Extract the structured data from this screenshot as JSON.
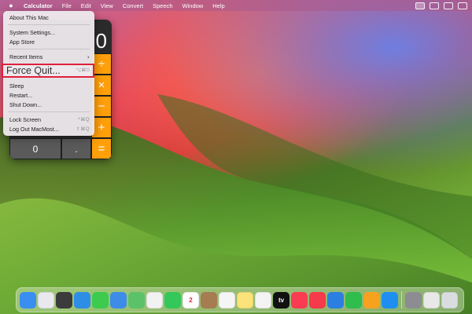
{
  "menubar": {
    "apple_icon": "apple-logo-icon",
    "items": [
      "Calculator",
      "File",
      "Edit",
      "View",
      "Convert",
      "Speech",
      "Window",
      "Help"
    ],
    "status_icons": [
      "screen-mirroring-icon",
      "window-icon",
      "video-icon",
      "control-center-icon"
    ]
  },
  "apple_menu": {
    "about": "About This Mac",
    "system_settings": "System Settings...",
    "app_store": "App Store",
    "recent_items": "Recent Items",
    "recent_items_arrow": "›",
    "force_quit": "Force Quit...",
    "force_quit_shortcut": "⌥⌘⎋",
    "sleep": "Sleep",
    "restart": "Restart...",
    "shut_down": "Shut Down...",
    "lock_screen": "Lock Screen",
    "lock_screen_shortcut": "^⌘Q",
    "log_out": "Log Out MacMost...",
    "log_out_shortcut": "⇧⌘Q",
    "highlight_color": "#e0203a"
  },
  "calculator": {
    "display": "0",
    "keys": {
      "zero": "0",
      "decimal": ".",
      "divide": "÷",
      "multiply": "×",
      "minus": "−",
      "plus": "+",
      "equals": "="
    },
    "colors": {
      "operator": "#ff9f0a",
      "number": "#5a5a5a",
      "body": "#2b2b2b"
    }
  },
  "dock": {
    "icons": [
      {
        "name": "finder-icon",
        "label": "",
        "color": "#3a8ef0"
      },
      {
        "name": "launchpad-icon",
        "label": "",
        "color": "#e8e8ee"
      },
      {
        "name": "calculator-icon",
        "label": "",
        "color": "#3b3b3b"
      },
      {
        "name": "safari-icon",
        "label": "",
        "color": "#2e8ee6"
      },
      {
        "name": "messages-icon",
        "label": "",
        "color": "#3ccb4f"
      },
      {
        "name": "mail-icon",
        "label": "",
        "color": "#3d8de8"
      },
      {
        "name": "maps-icon",
        "label": "",
        "color": "#5cc26a"
      },
      {
        "name": "photos-icon",
        "label": "",
        "color": "#f2f2f2"
      },
      {
        "name": "facetime-icon",
        "label": "",
        "color": "#34c759"
      },
      {
        "name": "calendar-icon",
        "label": "2",
        "color": "#ffffff"
      },
      {
        "name": "contacts-icon",
        "label": "",
        "color": "#a67c52"
      },
      {
        "name": "reminders-icon",
        "label": "",
        "color": "#f5f5f5"
      },
      {
        "name": "notes-icon",
        "label": "",
        "color": "#fbe27a"
      },
      {
        "name": "freeform-icon",
        "label": "",
        "color": "#f3f3f3"
      },
      {
        "name": "appletv-icon",
        "label": "tv",
        "color": "#111111"
      },
      {
        "name": "music-icon",
        "label": "",
        "color": "#fa3c52"
      },
      {
        "name": "news-icon",
        "label": "",
        "color": "#f43a4b"
      },
      {
        "name": "keynote-icon",
        "label": "",
        "color": "#2c7fe0"
      },
      {
        "name": "numbers-icon",
        "label": "",
        "color": "#2fbd4e"
      },
      {
        "name": "pages-icon",
        "label": "",
        "color": "#f6a21e"
      },
      {
        "name": "app-store-icon",
        "label": "",
        "color": "#1e8ff0"
      },
      {
        "name": "system-settings-icon",
        "label": "",
        "color": "#8c8c92"
      },
      {
        "name": "script-editor-icon",
        "label": "",
        "color": "#e8e8e8"
      },
      {
        "name": "trash-icon",
        "label": "",
        "color": "#d9dde0"
      }
    ]
  }
}
